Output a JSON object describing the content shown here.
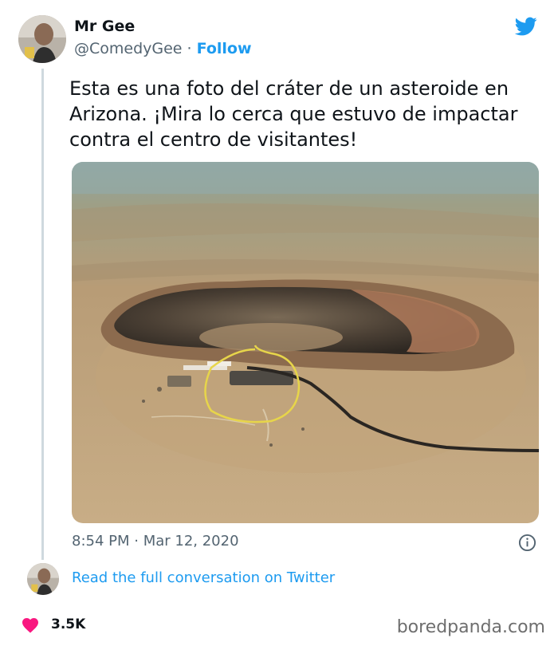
{
  "author": {
    "name": "Mr Gee",
    "handle": "@ComedyGee",
    "separator": "·",
    "follow_label": "Follow"
  },
  "tweet": {
    "text": "Esta es una foto del cráter de un asteroide en\nArizona. ¡Mira lo cerca que estuvo de impactar\ncontra el centro de visitantes!",
    "timestamp": "8:54 PM · Mar 12, 2020"
  },
  "conversation": {
    "link_label": "Read the full conversation on Twitter"
  },
  "engagement": {
    "likes": "3.5K"
  },
  "watermark": "boredpanda.com",
  "icons": {
    "brand": "twitter-bird-icon",
    "info": "info-icon",
    "like": "heart-icon"
  },
  "colors": {
    "accent": "#1d9bf0",
    "like": "#f91880",
    "secondary_text": "#536471"
  }
}
